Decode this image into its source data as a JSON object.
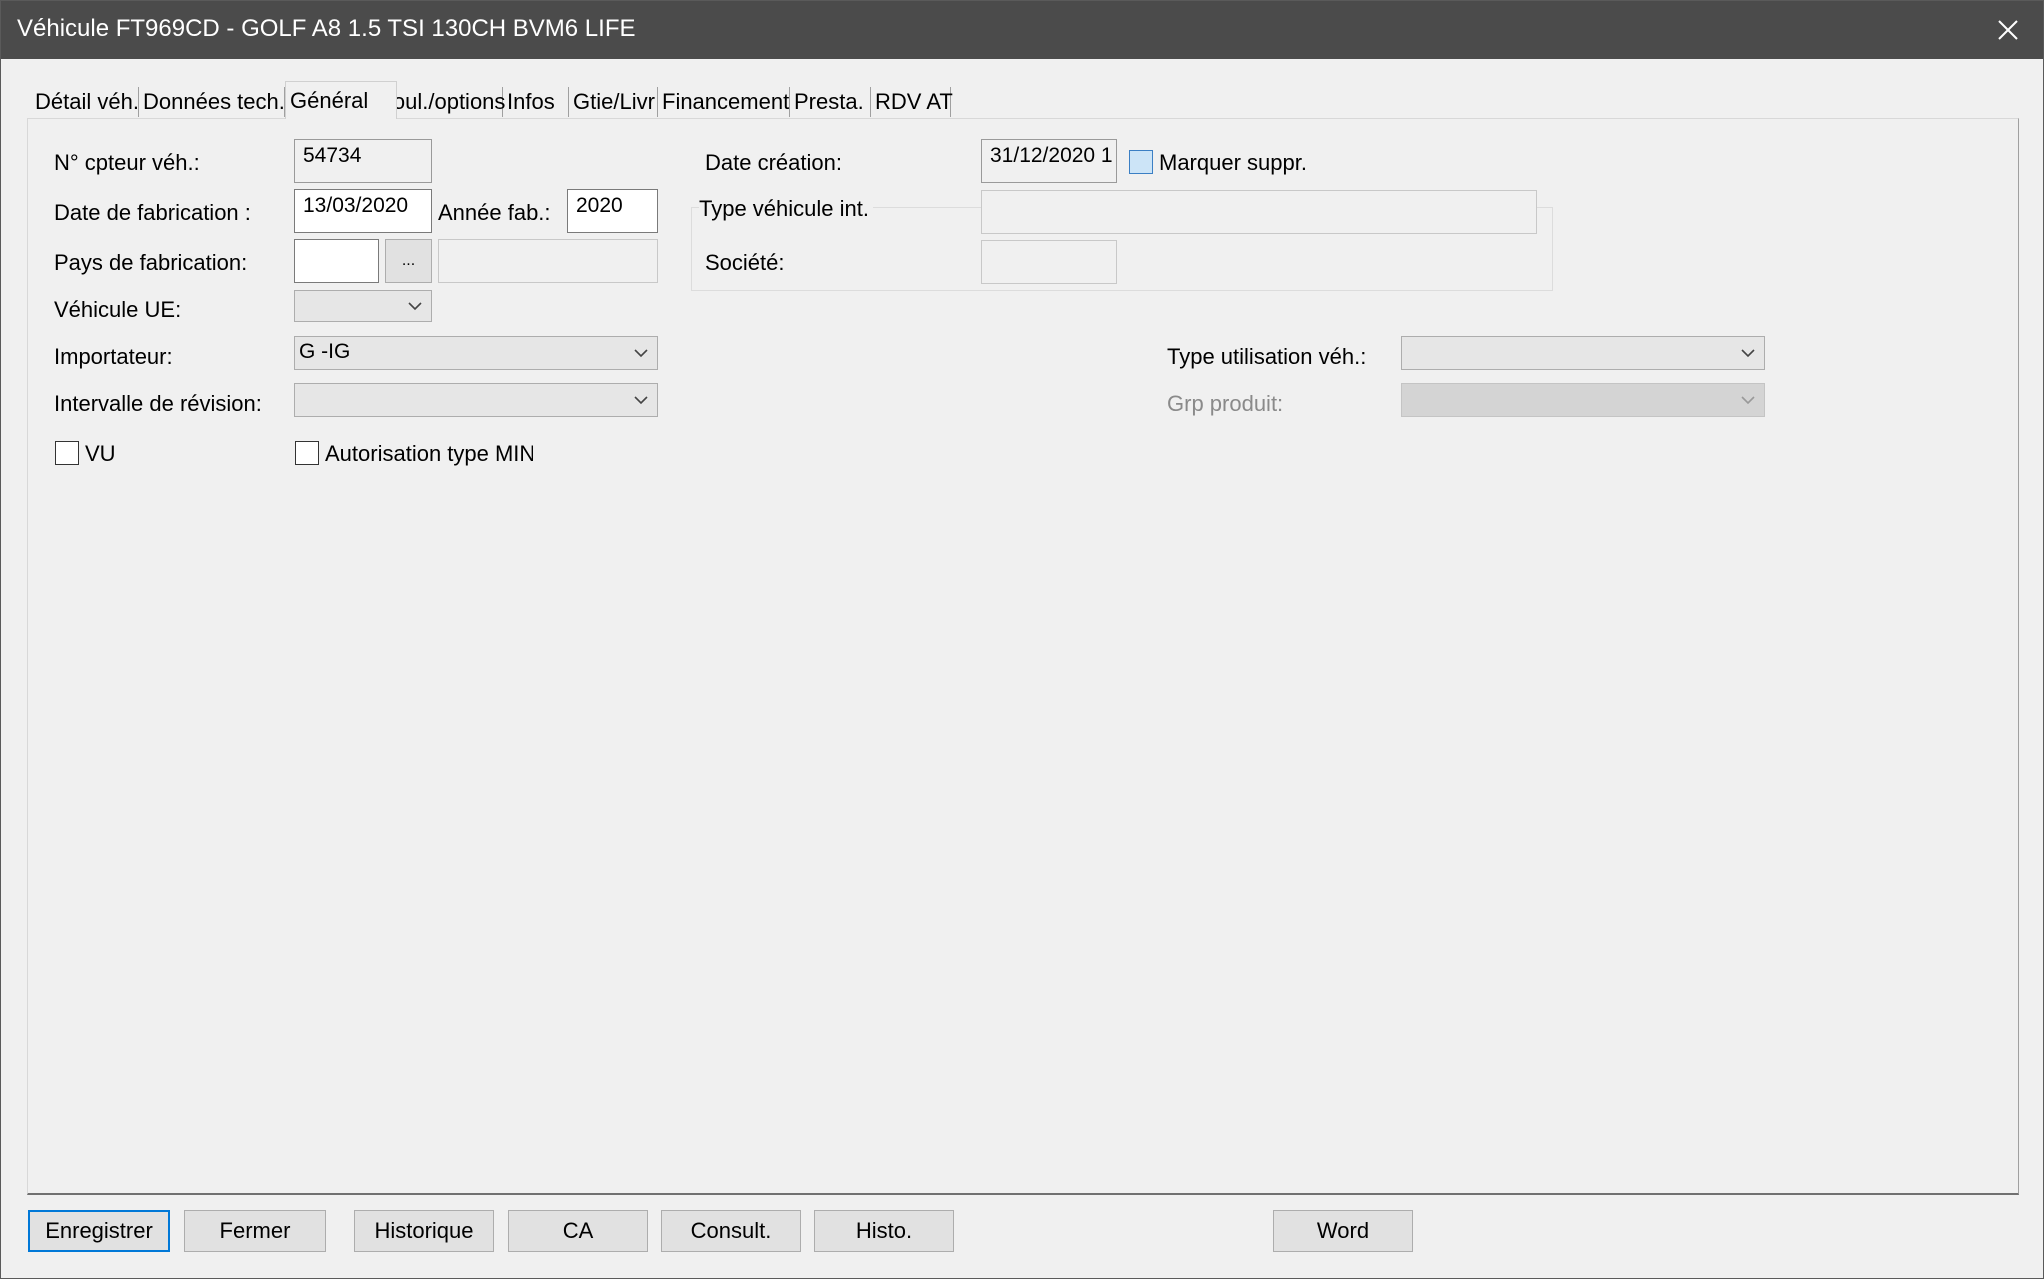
{
  "window": {
    "title": "Véhicule FT969CD - GOLF A8 1.5 TSI 130CH BVM6 LIFE"
  },
  "tabs": [
    {
      "label": "Détail véh."
    },
    {
      "label": "Données tech."
    },
    {
      "label": "Général"
    },
    {
      "label": "Coul./options"
    },
    {
      "label": "Infos"
    },
    {
      "label": "Gtie/Livr"
    },
    {
      "label": "Financement"
    },
    {
      "label": "Presta."
    },
    {
      "label": "RDV AT"
    }
  ],
  "active_tab": "Général",
  "form": {
    "compteur": {
      "label": "N° cpteur véh.:",
      "value": "54734"
    },
    "date_fabrication": {
      "label": "Date de fabrication :",
      "value": "13/03/2020"
    },
    "annee_fab": {
      "label": "Année fab.:",
      "value": "2020"
    },
    "pays_fabrication": {
      "label": "Pays de fabrication:",
      "code": "",
      "button": "...",
      "name": ""
    },
    "vehicule_ue": {
      "label": "Véhicule UE:",
      "value": ""
    },
    "importateur": {
      "label": "Importateur:",
      "value": "G -IG"
    },
    "intervalle_revision": {
      "label": "Intervalle de révision:",
      "value": ""
    },
    "vu": {
      "label": "VU",
      "checked": false
    },
    "autorisation_mini": {
      "label": "Autorisation type MINI",
      "checked": false
    },
    "date_creation": {
      "label": "Date création:",
      "value": "31/12/2020 1"
    },
    "marquer_suppr": {
      "label": "Marquer suppr.",
      "checked": false
    },
    "type_vehicule_int": {
      "label": "Type véhicule int.",
      "value": ""
    },
    "societe": {
      "label": "Société:",
      "value": ""
    },
    "type_utilisation": {
      "label": "Type utilisation véh.:",
      "value": ""
    },
    "grp_produit": {
      "label": "Grp produit:",
      "value": ""
    }
  },
  "buttons": {
    "enregistrer": "Enregistrer",
    "fermer": "Fermer",
    "historique": "Historique",
    "ca": "CA",
    "consult": "Consult.",
    "histo": "Histo.",
    "word": "Word"
  },
  "colors": {
    "titlebar": "#4b4b4b",
    "window_bg": "#f0f0f0",
    "default_button_border": "#0078d7"
  }
}
